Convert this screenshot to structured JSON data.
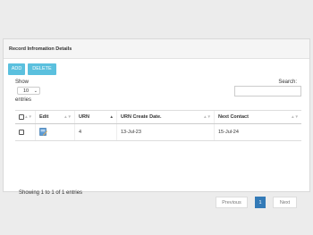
{
  "panel": {
    "title": "Record Infromation Details"
  },
  "toolbar": {
    "add_label": "ADD",
    "delete_label": "DELETE"
  },
  "length": {
    "show_label": "Show",
    "value": "10",
    "entries_label": "entries"
  },
  "search": {
    "label": "Search:",
    "value": ""
  },
  "table": {
    "headers": [
      "",
      "Edit",
      "URN",
      "URN Create Date.",
      "Next Contact"
    ],
    "rows": [
      {
        "urn": "4",
        "created": "13-Jul-23",
        "next_contact": "15-Jul-24"
      }
    ]
  },
  "info": "Showing 1 to 1 of 1 entries",
  "pagination": {
    "previous": "Previous",
    "page": "1",
    "next": "Next"
  },
  "icons": {
    "select_caret": "chevron-down-icon",
    "edit": "edit-icon",
    "sort": "sort-icon"
  },
  "colors": {
    "info_button": "#5bc0de",
    "active_page": "#337ab7"
  }
}
